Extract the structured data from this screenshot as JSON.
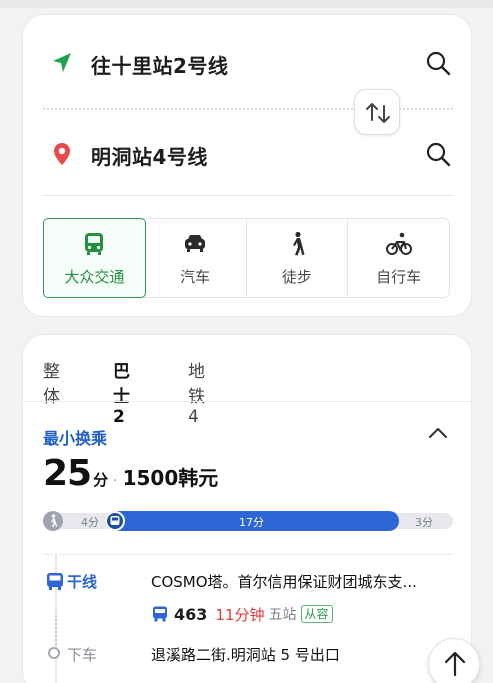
{
  "route": {
    "origin": "往十里站2号线",
    "destination": "明洞站4号线"
  },
  "modes": [
    {
      "label": "大众交通",
      "icon": "bus-icon",
      "active": true
    },
    {
      "label": "汽车",
      "icon": "car-icon",
      "active": false
    },
    {
      "label": "徒步",
      "icon": "walk-icon",
      "active": false
    },
    {
      "label": "自行车",
      "icon": "bike-icon",
      "active": false
    }
  ],
  "tabs": {
    "all": "整体",
    "bus": "巴士2",
    "subway": "地铁4"
  },
  "result": {
    "title": "最小换乘",
    "minutes": "25",
    "minutes_unit": "分",
    "dot": "·",
    "fare": "1500韩元",
    "progress": {
      "walk1": "4分",
      "bus": "17分",
      "walk2": "3分"
    },
    "segment1": {
      "label": "干线",
      "stop": "COSMO塔。首尔信用保证财团城东支...",
      "bus_number": "463",
      "duration": "11分钟",
      "stops": "五站",
      "badge": "从容"
    },
    "alight": {
      "label": "下车",
      "stop": "退溪路二街.明洞站 5 号出口"
    }
  },
  "colors": {
    "accent_green": "#2e9a53",
    "bus_blue": "#2d65d4",
    "origin_arrow": "#20a24b",
    "destination_pin": "#e84a4a",
    "late_red": "#e23b3b"
  }
}
